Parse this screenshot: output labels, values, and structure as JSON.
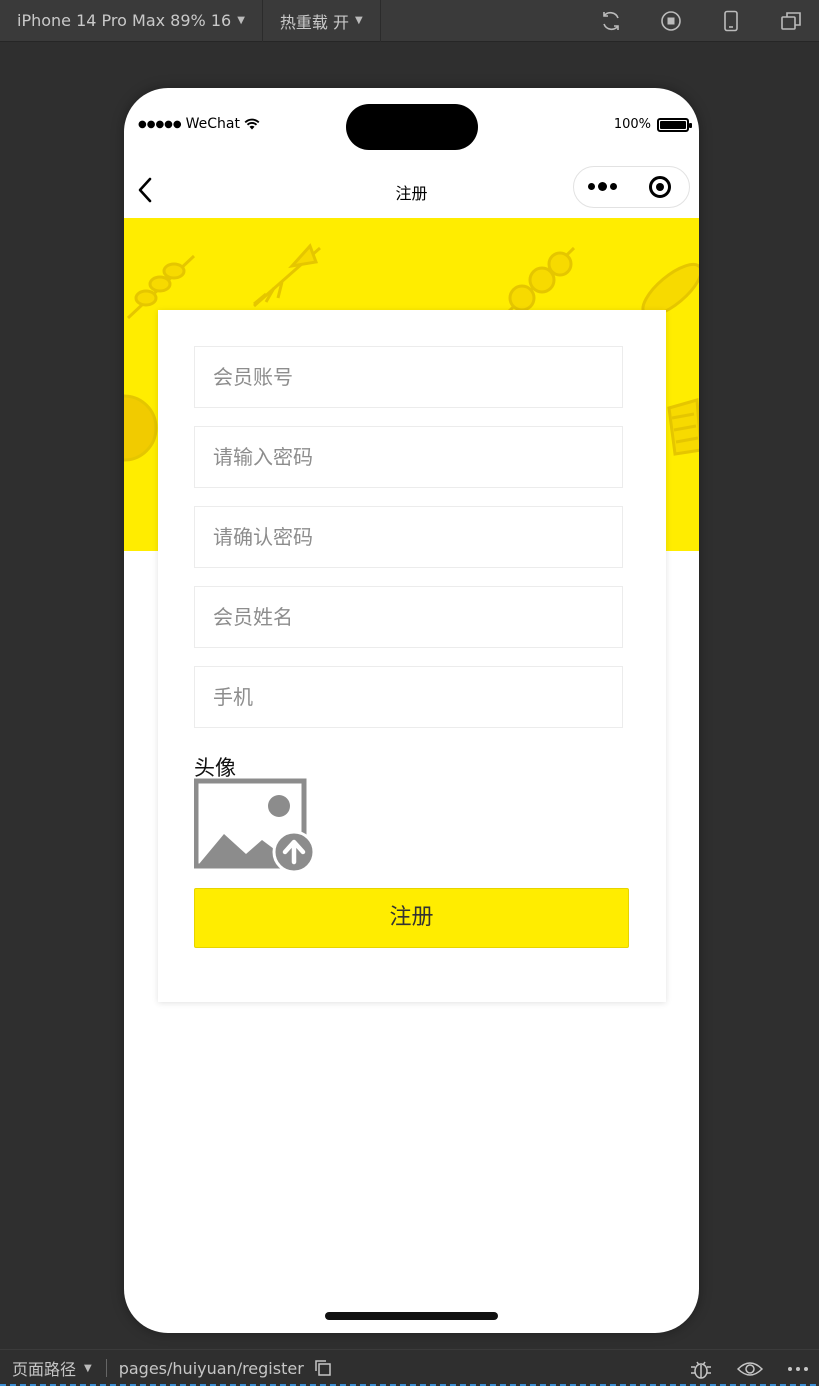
{
  "toolbar": {
    "device_label": "iPhone 14 Pro Max 89% 16",
    "hot_reload_label": "热重载 开",
    "icons": [
      "refresh-icon",
      "stop-icon",
      "phone-preview-icon",
      "window-icon"
    ]
  },
  "phone_status": {
    "carrier": "WeChat",
    "battery": "100%"
  },
  "navbar": {
    "title": "注册"
  },
  "form": {
    "fields": [
      {
        "placeholder": "会员账号",
        "value": ""
      },
      {
        "placeholder": "请输入密码",
        "value": ""
      },
      {
        "placeholder": "请确认密码",
        "value": ""
      },
      {
        "placeholder": "会员姓名",
        "value": ""
      },
      {
        "placeholder": "手机",
        "value": ""
      }
    ],
    "avatar_label": "头像",
    "submit_label": "注册"
  },
  "colors": {
    "accent": "#ffed00",
    "background_dark": "#2f2f2f"
  },
  "bottombar": {
    "path_label": "页面路径",
    "path": "pages/huiyuan/register"
  }
}
